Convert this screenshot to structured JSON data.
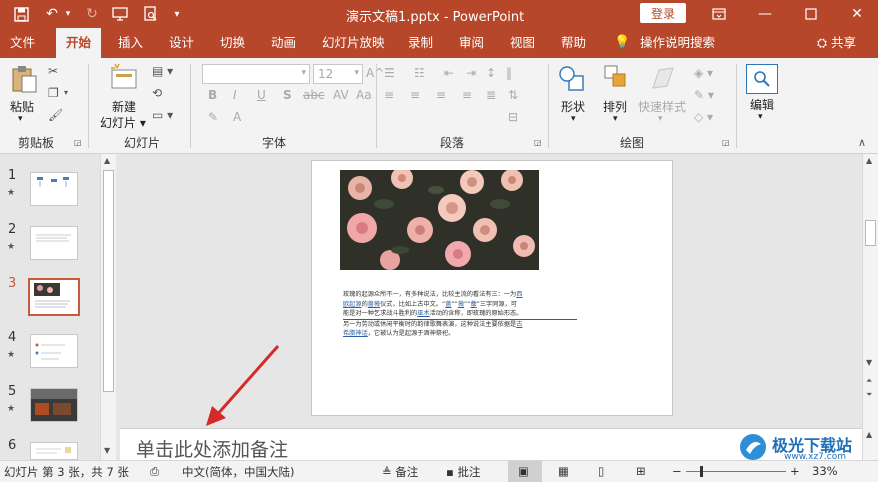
{
  "titlebar": {
    "title": "演示文稿1.pptx  -  PowerPoint",
    "login": "登录"
  },
  "tabs": [
    {
      "label": "文件"
    },
    {
      "label": "开始"
    },
    {
      "label": "插入"
    },
    {
      "label": "设计"
    },
    {
      "label": "切换"
    },
    {
      "label": "动画"
    },
    {
      "label": "幻灯片放映"
    },
    {
      "label": "录制"
    },
    {
      "label": "审阅"
    },
    {
      "label": "视图"
    },
    {
      "label": "帮助"
    },
    {
      "label": "操作说明搜索"
    }
  ],
  "share": "共享",
  "ribbon": {
    "paste": "粘贴",
    "new_slide_1": "新建",
    "new_slide_2": "幻灯片",
    "font_size": "12",
    "shape": "形状",
    "arrange": "排列",
    "quick_style": "快速样式",
    "edit": "编辑",
    "groups": {
      "clipboard": "剪贴板",
      "slides": "幻灯片",
      "font": "字体",
      "paragraph": "段落",
      "drawing": "绘图"
    }
  },
  "thumbnails": [
    {
      "num": "1",
      "star": "★"
    },
    {
      "num": "2",
      "star": "★"
    },
    {
      "num": "3",
      "star": ""
    },
    {
      "num": "4",
      "star": "★"
    },
    {
      "num": "5",
      "star": "★"
    },
    {
      "num": "6",
      "star": ""
    }
  ],
  "slide_text": {
    "l1a": "玫瑰的起源众所不一，有多种说法，比较主流的看法有三：一为",
    "l1b": "西",
    "l2a": "欧起源",
    "l2b": "的",
    "l2c": "蔷薇",
    "l2d": "仪式，比如上古中文。“",
    "l2e": "蔷",
    "l2f": "”“",
    "l2g": "薇",
    "l2h": "”“",
    "l2i": "蘼",
    "l2j": "”三字同源，可",
    "l3a": "能是对一种乞求战斗胜利的",
    "l3b": "巫术",
    "l3c": "活动的含称，即玫瑰的原始形态。",
    "l4": "另一为劳动或休闲平衡时的韵律歌舞表演，这种说法主要依据是",
    "l4b": "古",
    "l5a": "希腊神话",
    "l5b": "，它被认为是起源于酒神祭祀。"
  },
  "notes_placeholder": "单击此处添加备注",
  "status": {
    "slide_info": "幻灯片 第 3 张，共 7 张",
    "language": "中文(简体，中国大陆)",
    "notes": "备注",
    "comments": "批注",
    "zoom": "33%"
  },
  "watermark": {
    "name": "极光下载站",
    "url": "www.xz7.com"
  },
  "colors": {
    "accent": "#b7472a",
    "selected_thumb": "#c55a3c",
    "arrow": "#d42a2a"
  }
}
